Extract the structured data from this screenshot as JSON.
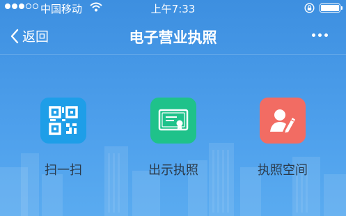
{
  "status_bar": {
    "carrier": "中国移动",
    "time": "上午7:33"
  },
  "nav": {
    "back_label": "返回",
    "title": "电子营业执照"
  },
  "actions": [
    {
      "label": "扫一扫",
      "icon": "qr-code-icon",
      "color": "#1e9ee8"
    },
    {
      "label": "出示执照",
      "icon": "certificate-icon",
      "color": "#1fc28a"
    },
    {
      "label": "执照空间",
      "icon": "user-edit-icon",
      "color": "#f26c63"
    }
  ],
  "colors": {
    "background": "#4a9ceb",
    "text_dark": "#2b3a4a"
  }
}
